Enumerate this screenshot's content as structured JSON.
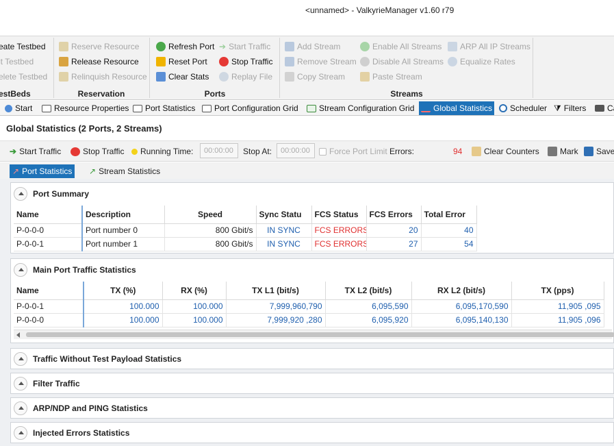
{
  "window": {
    "title": "<unnamed> - ValkyrieManager v1.60 r79"
  },
  "ribbon": {
    "testbeds": {
      "items": [
        "eate Testbed",
        "it Testbed",
        "elete Testbed"
      ],
      "group": "estBeds"
    },
    "reservation": {
      "items": [
        "Reserve Resource",
        "Release Resource",
        "Relinquish Resource"
      ],
      "group": "Reservation"
    },
    "ports": {
      "col1": [
        "Refresh Port",
        "Reset Port",
        "Clear Stats"
      ],
      "col2": [
        "Start Traffic",
        "Stop Traffic",
        "Replay File"
      ],
      "group": "Ports"
    },
    "streams": {
      "col1": [
        "Add Stream",
        "Remove Stream",
        "Copy Stream"
      ],
      "col2": [
        "Enable All Streams",
        "Disable All Streams",
        "Paste Stream"
      ],
      "col3": [
        "ARP All IP Streams",
        "Equalize Rates"
      ],
      "group": "Streams"
    }
  },
  "tabs": [
    "Start",
    "Resource Properties",
    "Port Statistics",
    "Port Configuration Grid",
    "Stream Configuration Grid",
    "Global Statistics",
    "Scheduler",
    "Filters",
    "Ca"
  ],
  "header": {
    "title": "Global Statistics (2 Ports, 2 Streams)"
  },
  "toolbar": {
    "start": "Start Traffic",
    "stop": "Stop Traffic",
    "running_label": "Running Time:",
    "running_value": "00:00:00",
    "stop_at_label": "Stop At:",
    "stop_at_value": "00:00:00",
    "force": "Force Port Limit",
    "errors_label": "Errors:",
    "errors_value": "94",
    "clear": "Clear Counters",
    "mark": "Mark",
    "save": "Save"
  },
  "subtabs": [
    "Port Statistics",
    "Stream Statistics"
  ],
  "port_summary": {
    "title": "Port Summary",
    "columns": [
      "Name",
      "Description",
      "Speed",
      "Sync Statu",
      "FCS Status",
      "FCS Errors",
      "Total Error"
    ],
    "rows": [
      [
        "P-0-0-0",
        "Port number 0",
        "800 Gbit/s",
        "IN SYNC",
        "FCS ERRORS",
        "20",
        "40"
      ],
      [
        "P-0-0-1",
        "Port number 1",
        "800 Gbit/s",
        "IN SYNC",
        "FCS ERRORS",
        "27",
        "54"
      ]
    ]
  },
  "main_traffic": {
    "title": "Main Port Traffic Statistics",
    "columns": [
      "Name",
      "TX (%)",
      "RX (%)",
      "TX L1 (bit/s)",
      "TX L2 (bit/s)",
      "RX L2 (bit/s)",
      "TX (pps)"
    ],
    "rows": [
      [
        "P-0-0-1",
        "100.000",
        "100.000",
        "7,999,960,790",
        "6,095,590",
        "6,095,170,590",
        "11,905 ,095"
      ],
      [
        "P-0-0-0",
        "100.000",
        "100.000",
        "7,999,920 ,280",
        "6,095,920",
        "6,095,140,130",
        "11,905 ,096"
      ]
    ]
  },
  "collapsed_sections": [
    "Traffic Without Test Payload Statistics",
    "Filter Traffic",
    "ARP/NDP and PING Statistics",
    "Injected Errors Statistics"
  ],
  "colors": {
    "accent": "#1e72b8",
    "error": "#e03030",
    "value": "#1f5fae"
  }
}
